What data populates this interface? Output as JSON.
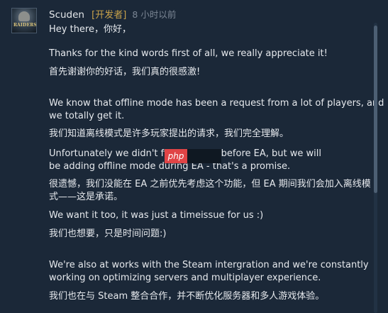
{
  "comment": {
    "author": "Scuden",
    "badge": "[开发者]",
    "timestamp": "8 小时以前",
    "avatar_label": "RAIDERS",
    "paragraphs": {
      "p1": "Hey there，你好，",
      "p2": "Thanks for the kind words first of all, we really appreciate it!",
      "p3": "首先谢谢你的好话，我们真的很感激!",
      "p4a": "We know that offline mode has been a request from a lot of players, and",
      "p4b": "we totally get it.",
      "p5": "我们知道离线模式是许多玩家提出的请求，我们完全理解。",
      "p6a": "Unfortunately we didn't fin                    ritize this before EA, but we will",
      "p6b": "be adding offline mode during EA - that's a promise.",
      "p7a": "很遗憾，我们没能在 EA 之前优先考虑这个功能，但 EA 期间我们会加入离线模",
      "p7b": "式——这是承诺。",
      "p8": "We want it too, it was just a timeissue for us :)",
      "p9": "我们也想要，只是时间问题:)",
      "p10a": "We're also at works with the Steam intergration and we're constantly",
      "p10b": "working on optimizing servers and multiplayer experience.",
      "p11": "我们也在与 Steam 整合合作，并不断优化服务器和多人游戏体验。"
    }
  },
  "watermark": {
    "text": "php"
  },
  "colors": {
    "background": "#1b2838",
    "text": "#e6e9ed",
    "developer_badge": "#c8a24a",
    "timestamp": "#7b8694",
    "watermark": "#e04446"
  },
  "icons": {
    "avatar": "game-logo-avatar"
  }
}
